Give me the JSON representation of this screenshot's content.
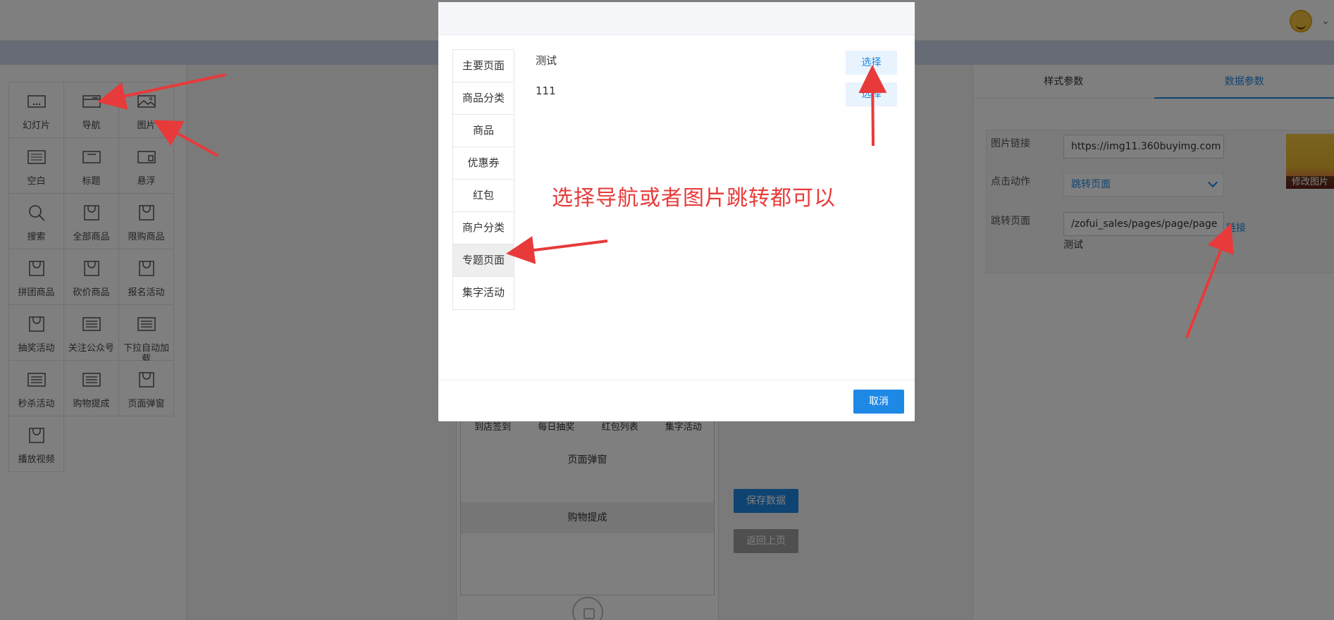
{
  "widgets": [
    {
      "label": "幻灯片",
      "icon": "slideshow-icon"
    },
    {
      "label": "导航",
      "icon": "navigation-icon"
    },
    {
      "label": "图片",
      "icon": "image-icon"
    },
    {
      "label": "空白",
      "icon": "blank-icon"
    },
    {
      "label": "标题",
      "icon": "title-icon"
    },
    {
      "label": "悬浮",
      "icon": "float-icon"
    },
    {
      "label": "搜索",
      "icon": "search-icon"
    },
    {
      "label": "全部商品",
      "icon": "bag-icon"
    },
    {
      "label": "限购商品",
      "icon": "bag-icon"
    },
    {
      "label": "拼团商品",
      "icon": "bag-icon"
    },
    {
      "label": "砍价商品",
      "icon": "bag-icon"
    },
    {
      "label": "报名活动",
      "icon": "bag-icon"
    },
    {
      "label": "抽奖活动",
      "icon": "bag-icon"
    },
    {
      "label": "关注公众号",
      "icon": "list-icon"
    },
    {
      "label": "下拉自动加载",
      "icon": "list-icon"
    },
    {
      "label": "秒杀活动",
      "icon": "list-icon"
    },
    {
      "label": "购物提成",
      "icon": "list-icon"
    },
    {
      "label": "页面弹窗",
      "icon": "bag-icon"
    },
    {
      "label": "播放视频",
      "icon": "bag-icon"
    }
  ],
  "phone": {
    "nav": [
      "到店签到",
      "每日抽奖",
      "红包列表",
      "集字活动"
    ],
    "row1": "页面弹窗",
    "row2": "购物提成"
  },
  "actions": {
    "save": "保存数据",
    "back": "返回上页"
  },
  "right_panel": {
    "tabs": [
      "样式参数",
      "数据参数"
    ],
    "active_tab": "数据参数",
    "image_link_label": "图片链接",
    "image_link_value": "https://img11.360buyimg.com",
    "click_action_label": "点击动作",
    "click_action_value": "跳转页面",
    "jump_page_label": "跳转页面",
    "jump_page_value": "/zofui_sales/pages/page/page",
    "link_label": "链接",
    "jump_page_name": "测试",
    "change_image_label": "修改图片"
  },
  "modal": {
    "categories": [
      "主要页面",
      "商品分类",
      "商品",
      "优惠券",
      "红包",
      "商户分类",
      "专题页面",
      "集字活动"
    ],
    "active_category": "专题页面",
    "results": [
      {
        "name": "测试",
        "button": "选择"
      },
      {
        "name": "111",
        "button": "选择"
      }
    ],
    "cancel": "取消",
    "annotation": "选择导航或者图片跳转都可以"
  },
  "colors": {
    "accent": "#1e88e5",
    "annotation": "#e83a3a",
    "overlay": "rgba(0,0,0,0.5)"
  }
}
